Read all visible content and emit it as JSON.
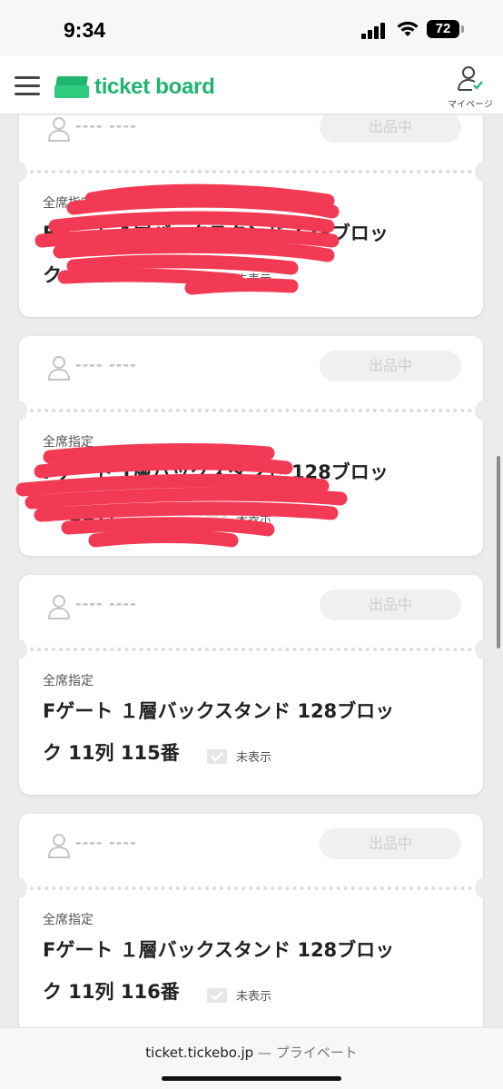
{
  "status_bar": {
    "time": "9:34",
    "battery": "72"
  },
  "header": {
    "logo_text": "ticket board",
    "mypage_label": "マイページ"
  },
  "colors": {
    "brand_green": "#1fb46f",
    "redaction": "#f23a55"
  },
  "cards": [
    {
      "name": "---- ----",
      "status": "出品中",
      "seat_type": "全席指定",
      "seat_line1": "Fゲート 1層バックスタンド 128ブロッ",
      "seat_line2": "ク",
      "hidden_label": "未表示"
    },
    {
      "name": "---- ----",
      "status": "出品中",
      "seat_type": "全席指定",
      "seat_line1": "Fゲート 1層バックスタンド 128ブロッ",
      "seat_line2": "ク 11列",
      "hidden_label": "未表示"
    },
    {
      "name": "---- ----",
      "status": "出品中",
      "seat_type": "全席指定",
      "seat_line1": "Fゲート １層バックスタンド 128ブロッ",
      "seat_line2": "ク 11列 115番",
      "hidden_label": "未表示"
    },
    {
      "name": "---- ----",
      "status": "出品中",
      "seat_type": "全席指定",
      "seat_line1": "Fゲート １層バックスタンド 128ブロッ",
      "seat_line2": "ク 11列 116番",
      "hidden_label": "未表示"
    }
  ],
  "url_bar": {
    "domain": "ticket.tickebo.jp",
    "separator": " — ",
    "mode": "プライベート"
  }
}
